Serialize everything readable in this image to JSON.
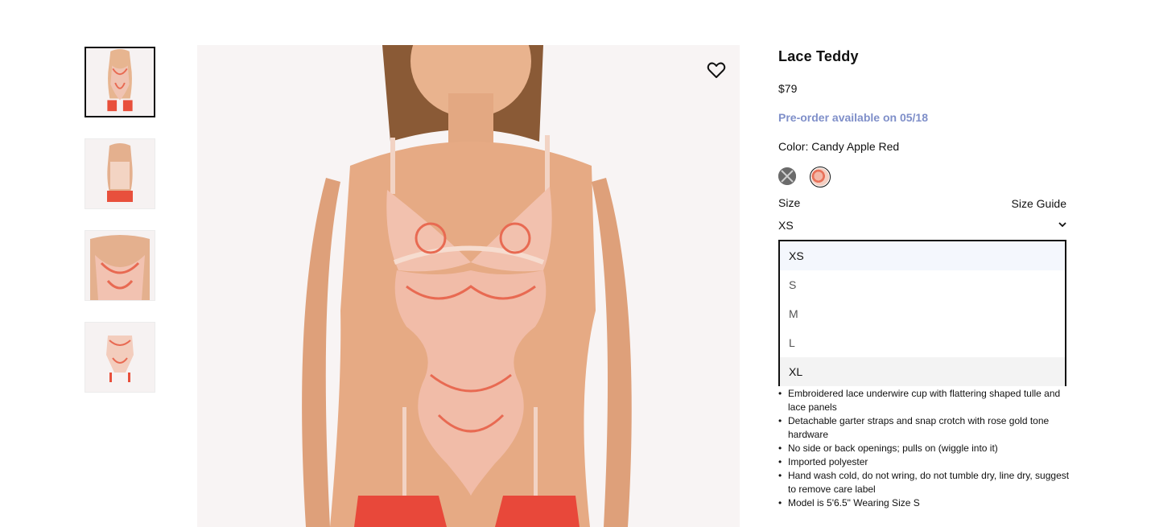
{
  "product": {
    "title": "Lace Teddy",
    "price": "$79",
    "preorder": "Pre-order available on 05/18",
    "color_label": "Color: Candy Apple Red",
    "size_label": "Size",
    "size_guide": "Size Guide",
    "selected_size": "XS",
    "size_options": [
      "XS",
      "S",
      "M",
      "L",
      "XL"
    ],
    "details": [
      "Embroidered lace underwire cup with flattering shaped tulle and lace panels",
      "Detachable garter straps and snap crotch with rose gold tone hardware",
      "No side or back openings; pulls on (wiggle into it)",
      "Imported polyester",
      "Hand wash cold, do not wring, do not tumble dry, line dry, suggest to remove care label",
      "Model is 5'6.5\" Wearing Size S"
    ]
  },
  "colors": {
    "accent_preorder": "#7f8fc9",
    "swatch_one": "#6b6b6b",
    "swatch_two": "#e9725a"
  },
  "icons": {
    "wishlist": "heart-icon",
    "size_dropdown": "chevron-down-icon"
  }
}
